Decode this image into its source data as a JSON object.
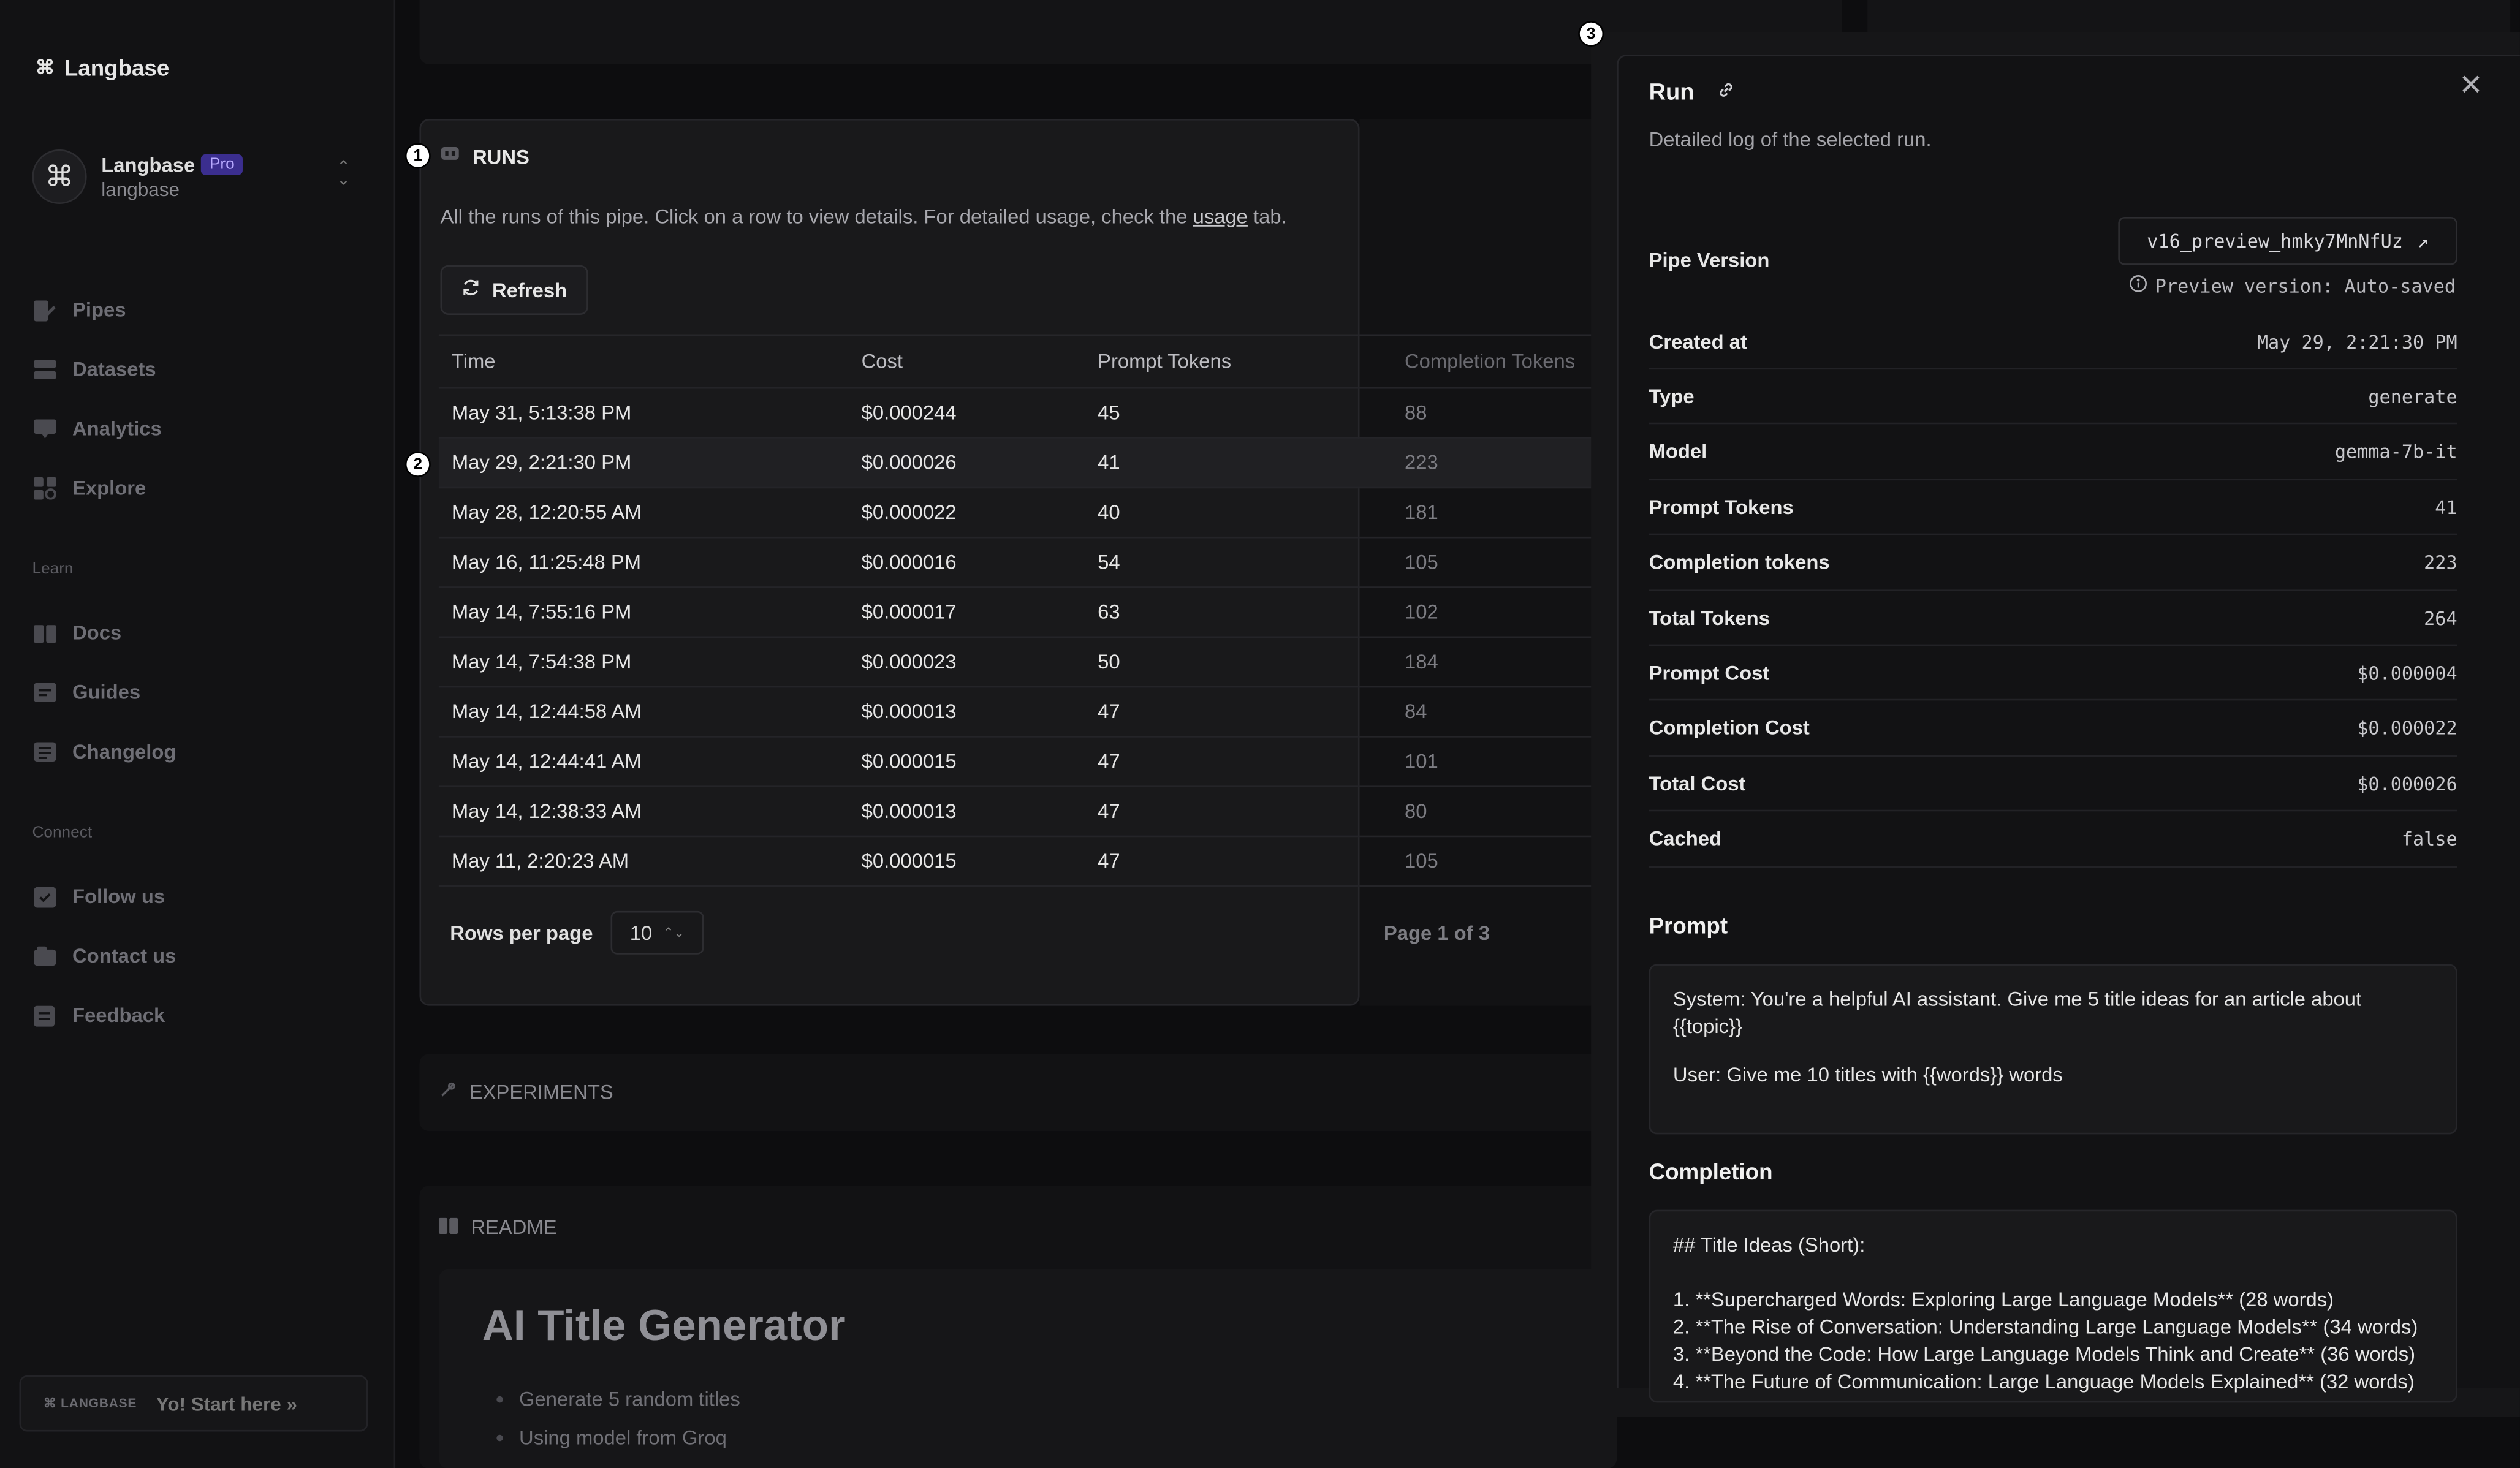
{
  "brand": {
    "name": "Langbase"
  },
  "org": {
    "name": "Langbase",
    "plan": "Pro",
    "handle": "langbase"
  },
  "nav": {
    "main": [
      {
        "label": "Pipes",
        "icon": "pipes-icon"
      },
      {
        "label": "Datasets",
        "icon": "datasets-icon"
      },
      {
        "label": "Analytics",
        "icon": "analytics-icon"
      },
      {
        "label": "Explore",
        "icon": "explore-icon"
      }
    ],
    "learn_label": "Learn",
    "learn": [
      {
        "label": "Docs",
        "icon": "docs-icon"
      },
      {
        "label": "Guides",
        "icon": "guides-icon"
      },
      {
        "label": "Changelog",
        "icon": "changelog-icon"
      }
    ],
    "connect_label": "Connect",
    "connect": [
      {
        "label": "Follow us",
        "icon": "follow-icon"
      },
      {
        "label": "Contact us",
        "icon": "contact-icon"
      },
      {
        "label": "Feedback",
        "icon": "feedback-icon"
      }
    ]
  },
  "start_card": {
    "brand": "⌘ LANGBASE",
    "text": "Yo! Start here",
    "arrow": "»"
  },
  "runs": {
    "title": "RUNS",
    "description_before": "All the runs of this pipe. Click on a row to view details. For detailed usage, check the ",
    "description_link": "usage",
    "description_after": " tab.",
    "refresh_label": "Refresh",
    "columns": [
      "Time",
      "Cost",
      "Prompt Tokens",
      "Completion Tokens"
    ],
    "rows": [
      [
        "May 31, 5:13:38 PM",
        "$0.000244",
        "45",
        "88"
      ],
      [
        "May 29, 2:21:30 PM",
        "$0.000026",
        "41",
        "223"
      ],
      [
        "May 28, 12:20:55 AM",
        "$0.000022",
        "40",
        "181"
      ],
      [
        "May 16, 11:25:48 PM",
        "$0.000016",
        "54",
        "105"
      ],
      [
        "May 14, 7:55:16 PM",
        "$0.000017",
        "63",
        "102"
      ],
      [
        "May 14, 7:54:38 PM",
        "$0.000023",
        "50",
        "184"
      ],
      [
        "May 14, 12:44:58 AM",
        "$0.000013",
        "47",
        "84"
      ],
      [
        "May 14, 12:44:41 AM",
        "$0.000015",
        "47",
        "101"
      ],
      [
        "May 14, 12:38:33 AM",
        "$0.000013",
        "47",
        "80"
      ],
      [
        "May 11, 2:20:23 AM",
        "$0.000015",
        "47",
        "105"
      ]
    ],
    "rows_per_page_label": "Rows per page",
    "rows_per_page_value": "10",
    "page_info": "Page 1 of 3"
  },
  "experiments": {
    "title": "EXPERIMENTS"
  },
  "readme": {
    "title": "README",
    "heading": "AI Title Generator",
    "bullets": [
      "Generate 5 random titles",
      "Using model from Groq"
    ]
  },
  "run_detail": {
    "title": "Run",
    "description": "Detailed log of the selected run.",
    "pipe_version_label": "Pipe Version",
    "pipe_version_value": "v16_preview_hmky7MnNfUz",
    "preview_note": "Preview version: Auto-saved",
    "fields": [
      {
        "key": "Created at",
        "value": "May 29, 2:21:30 PM"
      },
      {
        "key": "Type",
        "value": "generate"
      },
      {
        "key": "Model",
        "value": "gemma-7b-it"
      },
      {
        "key": "Prompt Tokens",
        "value": "41"
      },
      {
        "key": "Completion tokens",
        "value": "223"
      },
      {
        "key": "Total Tokens",
        "value": "264"
      },
      {
        "key": "Prompt Cost",
        "value": "$0.000004"
      },
      {
        "key": "Completion Cost",
        "value": "$0.000022"
      },
      {
        "key": "Total Cost",
        "value": "$0.000026"
      },
      {
        "key": "Cached",
        "value": "false"
      }
    ],
    "prompt_title": "Prompt",
    "prompt_system": "System: You're a helpful AI assistant. Give me 5 title ideas for an article about {{topic}}",
    "prompt_user": "User: Give me 10 titles with {{words}} words",
    "completion_title": "Completion",
    "completion_lines": [
      "## Title Ideas (Short):",
      "",
      "1. **Supercharged Words: Exploring Large Language Models** (28 words)",
      "2. **The Rise of Conversation: Understanding Large Language Models** (34 words)",
      "3. **Beyond the Code: How Large Language Models Think and Create** (36 words)",
      "4. **The Future of Communication: Large Language Models Explained** (32 words)"
    ]
  },
  "markers": [
    "1",
    "2",
    "3"
  ]
}
